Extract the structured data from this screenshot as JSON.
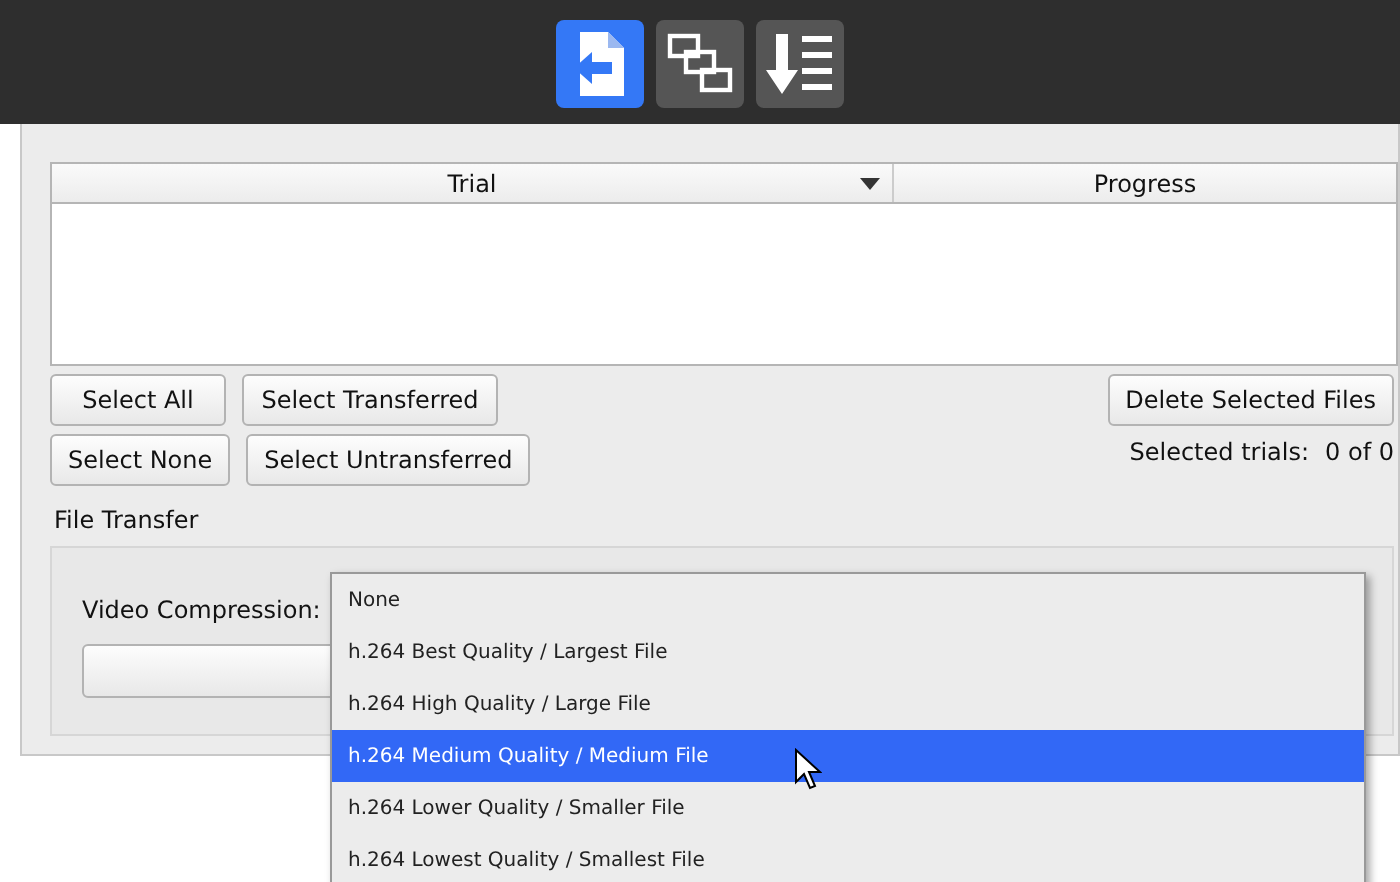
{
  "toolbar": {
    "items": [
      {
        "kind": "import",
        "selected": true
      },
      {
        "kind": "windows",
        "selected": false
      },
      {
        "kind": "list",
        "selected": false
      }
    ]
  },
  "table": {
    "columns": [
      {
        "label": "Trial",
        "menu": true
      },
      {
        "label": "Progress",
        "menu": false
      }
    ]
  },
  "select_buttons": [
    [
      "Select All",
      "Select Transferred"
    ],
    [
      "Select None",
      "Select Untransferred"
    ]
  ],
  "delete_button": "Delete Selected Files",
  "selected_trials": {
    "label": "Selected trials:",
    "value": "0 of 0"
  },
  "file_transfer": {
    "title": "File Transfer",
    "video_compression": {
      "label": "Video Compression:",
      "options": [
        {
          "label": "None",
          "selected": false
        },
        {
          "label": "h.264 Best Quality / Largest File",
          "selected": false
        },
        {
          "label": "h.264 High Quality / Large File",
          "selected": false
        },
        {
          "label": "h.264 Medium Quality / Medium File",
          "selected": true
        },
        {
          "label": "h.264 Lower Quality / Smaller File",
          "selected": false
        },
        {
          "label": "h.264 Lowest Quality / Smallest File",
          "selected": false
        }
      ]
    }
  }
}
